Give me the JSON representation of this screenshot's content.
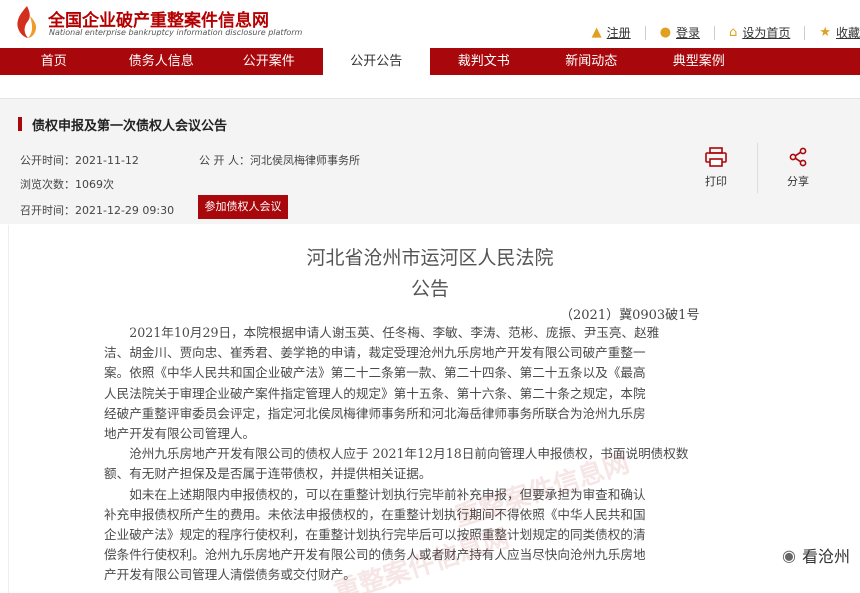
{
  "header": {
    "brand_cn": "全国企业破产重整案件信息网",
    "brand_en": "National enterprise bankruptcy information disclosure platform",
    "links": [
      {
        "icon": "user-icon",
        "label": "注册"
      },
      {
        "icon": "key-icon",
        "label": "登录"
      },
      {
        "icon": "home-icon",
        "label": "设为首页"
      },
      {
        "icon": "star-icon",
        "label": "收藏"
      }
    ]
  },
  "nav": {
    "items": [
      "首页",
      "债务人信息",
      "公开案件",
      "公开公告",
      "裁判文书",
      "新闻动态",
      "典型案例"
    ],
    "active": "公开公告"
  },
  "notice": {
    "title": "债权申报及第一次债权人会议公告",
    "publish_time": "公开时间：2021-11-12",
    "publisher": "公 开 人：河北侯凤梅律师事务所",
    "views": "浏览次数：1069次",
    "meeting_time": "召开时间：2021-12-29 09:30",
    "join_label": "参加债权人会议",
    "print_label": "打印",
    "share_label": "分享"
  },
  "document": {
    "court": "河北省沧州市运河区人民法院",
    "heading": "公告",
    "case_no": "（2021）冀0903破1号",
    "lines": [
      "　　2021年10月29日，本院根据申请人谢玉英、任冬梅、李敏、李涛、范彬、庞振、尹玉亮、赵雅",
      "洁、胡金川、贾向忠、崔秀君、姜学艳的申请，裁定受理沧州九乐房地产开发有限公司破产重整一",
      "案。依照《中华人民共和国企业破产法》第二十二条第一款、第二十四条、第二十五条以及《最高",
      "人民法院关于审理企业破产案件指定管理人的规定》第十五条、第十六条、第二十条之规定，本院",
      "经破产重整评审委员会评定，指定河北侯凤梅律师事务所和河北海岳律师事务所联合为沧州九乐房",
      "地产开发有限公司管理人。",
      "　　沧州九乐房地产开发有限公司的债权人应于 2021年12月18日前向管理人申报债权，书面说明债权数",
      "额、有无财产担保及是否属于连带债权，并提供相关证据。",
      "　　如未在上述期限内申报债权的，可以在重整计划执行完毕前补充申报，但要承担为审查和确认",
      "补充申报债权所产生的费用。未依法申报债权的，在重整计划执行期间不得依照《中华人民共和国",
      "企业破产法》规定的程序行使权利，在重整计划执行完毕后可以按照重整计划规定的同类债权的清",
      "偿条件行使权利。沧州九乐房地产开发有限公司的债务人或者财产持有人应当尽快向沧州九乐房地",
      "产开发有限公司管理人清偿债务或交付财产。"
    ]
  },
  "watermark": "重整案件信息网",
  "wechat_label": "看沧州"
}
